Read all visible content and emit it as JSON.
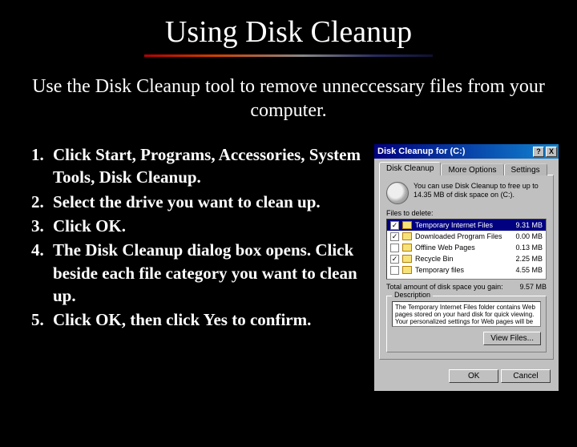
{
  "title": "Using Disk Cleanup",
  "subtitle": "Use the Disk Cleanup tool to remove unneccessary files from your computer.",
  "steps": [
    "Click Start, Programs, Accessories, System Tools, Disk Cleanup.",
    "Select the drive you want to clean up.",
    "Click OK.",
    "The Disk Cleanup dialog box opens. Click beside each file category you want to clean up.",
    "Click OK, then click Yes to confirm."
  ],
  "dialog": {
    "title": "Disk Cleanup for  (C:)",
    "window_buttons": {
      "help": "?",
      "close": "X"
    },
    "tabs": [
      "Disk Cleanup",
      "More Options",
      "Settings"
    ],
    "active_tab": 0,
    "intro": "You can use Disk Cleanup to free up to 14.35 MB of disk space on (C:).",
    "files_label": "Files to delete:",
    "items": [
      {
        "checked": true,
        "selected": true,
        "name": "Temporary Internet Files",
        "size": "9.31 MB"
      },
      {
        "checked": true,
        "selected": false,
        "name": "Downloaded Program Files",
        "size": "0.00 MB"
      },
      {
        "checked": false,
        "selected": false,
        "name": "Offline Web Pages",
        "size": "0.13 MB"
      },
      {
        "checked": true,
        "selected": false,
        "name": "Recycle Bin",
        "size": "2.25 MB"
      },
      {
        "checked": false,
        "selected": false,
        "name": "Temporary files",
        "size": "4.55 MB"
      }
    ],
    "total_label": "Total amount of disk space you gain:",
    "total_value": "9.57 MB",
    "description_legend": "Description",
    "description_text": "The Temporary Internet Files folder contains Web pages stored on your hard disk for quick viewing. Your personalized settings for Web pages will be left intact.",
    "view_files_btn": "View Files...",
    "ok_btn": "OK",
    "cancel_btn": "Cancel"
  }
}
